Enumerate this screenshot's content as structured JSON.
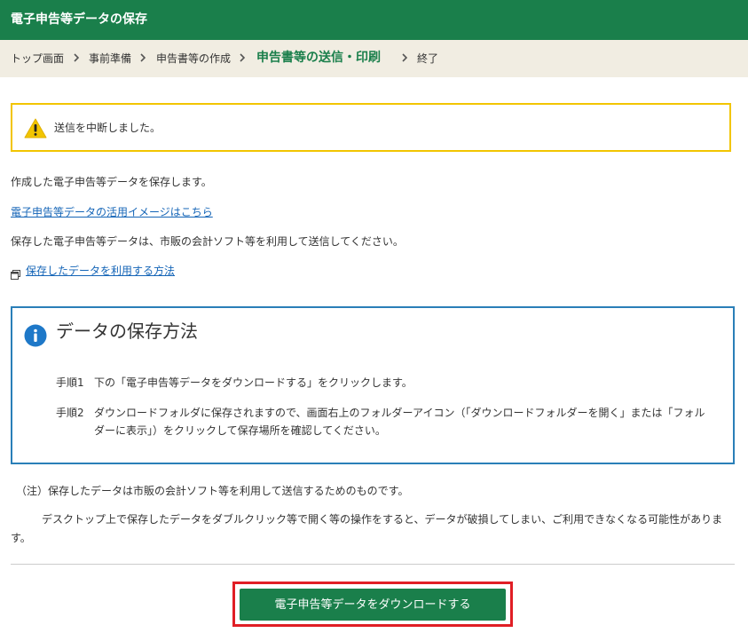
{
  "header": {
    "title": "電子申告等データの保存"
  },
  "breadcrumb": {
    "items": [
      {
        "label": "トップ画面"
      },
      {
        "label": "事前準備"
      },
      {
        "label": "申告書等の作成"
      },
      {
        "label": "申告書等の送信・印刷",
        "current": true
      },
      {
        "label": "終了"
      }
    ]
  },
  "alert": {
    "icon": "warning-icon",
    "message": "送信を中断しました。"
  },
  "main": {
    "intro": "作成した電子申告等データを保存します。",
    "usage_link": "電子申告等データの活用イメージはこちら",
    "send_note": "保存した電子申告等データは、市販の会計ソフト等を利用して送信してください。",
    "method_link": "保存したデータを利用する方法"
  },
  "info_box": {
    "icon": "info-icon",
    "title": "データの保存方法",
    "steps": [
      {
        "label": "手順1",
        "lines": [
          "下の「電子申告等データをダウンロードする」をクリックします。"
        ]
      },
      {
        "label": "手順2",
        "lines": [
          "ダウンロードフォルダに保存されますので、画面右上のフォルダーアイコン（「ダウンロードフォルダーを開く」または「フォル",
          "ダーに表示」）をクリックして保存場所を確認してください。"
        ]
      }
    ]
  },
  "notes": {
    "line1": "（注）保存したデータは市販の会計ソフト等を利用して送信するためのものです。",
    "line2": "デスクトップ上で保存したデータをダブルクリック等で開く等の操作をすると、データが破損してしまい、ご利用できなくなる可能性がありま",
    "line3": "す。"
  },
  "download": {
    "label": "電子申告等データをダウンロードする"
  },
  "colors": {
    "brand_green": "#1a7f4b",
    "alert_border": "#f2c500",
    "info_border": "#2a7fb8",
    "highlight_red": "#e01e25",
    "link": "#1565b7"
  }
}
